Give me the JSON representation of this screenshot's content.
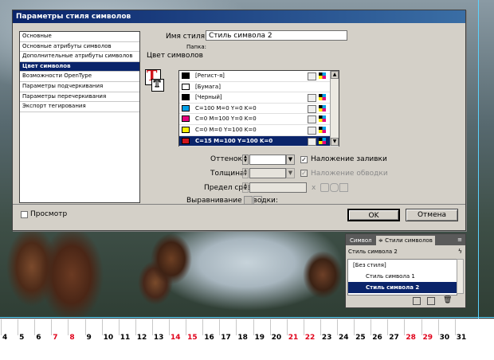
{
  "dialog": {
    "title": "Параметры стиля символов",
    "style_name_label": "Имя стиля:",
    "style_name_value": "Стиль символа 2",
    "folder_label": "Папка:",
    "section_title": "Цвет символов",
    "nav_items": [
      {
        "label": "Основные",
        "selected": false
      },
      {
        "label": "Основные атрибуты символов",
        "selected": false
      },
      {
        "label": "Дополнительные атрибуты символов",
        "selected": false
      },
      {
        "label": "Цвет символов",
        "selected": true
      },
      {
        "label": "Возможности OpenType",
        "selected": false
      },
      {
        "label": "Параметры подчеркивания",
        "selected": false
      },
      {
        "label": "Параметры перечеркивания",
        "selected": false
      },
      {
        "label": "Экспорт тегирования",
        "selected": false
      }
    ],
    "swatches": [
      {
        "name": "[Регист-я]",
        "color": "#000000",
        "selected": false
      },
      {
        "name": "[Бумага]",
        "color": "#ffffff",
        "selected": false
      },
      {
        "name": "[Черный]",
        "color": "#000000",
        "selected": false
      },
      {
        "name": "C=100 M=0 Y=0 K=0",
        "color": "#00a0e6",
        "selected": false
      },
      {
        "name": "C=0 M=100 Y=0 K=0",
        "color": "#e6007e",
        "selected": false
      },
      {
        "name": "C=0 M=0 Y=100 K=0",
        "color": "#fff000",
        "selected": false
      },
      {
        "name": "C=15 M=100 Y=100 K=0",
        "color": "#d2151c",
        "selected": true
      }
    ],
    "tint_label": "Оттенок:",
    "overprint_fill_label": "Наложение заливки",
    "weight_label": "Толщина:",
    "overprint_stroke_label": "Наложение обводки",
    "miter_label": "Предел среза:",
    "miter_unit": "x",
    "stroke_align_label": "Выравнивание обводки:",
    "preview_label": "Просмотр",
    "ok_label": "OK",
    "cancel_label": "Отмена"
  },
  "panel": {
    "tab_swatches": "Символ",
    "tab_styles": "≑ Стили символов",
    "current_style": "Стиль символа 2",
    "items": [
      {
        "label": "[Без стиля]",
        "selected": false
      },
      {
        "label": "Стиль символа 1",
        "selected": false
      },
      {
        "label": "Стиль символа 2",
        "selected": true
      }
    ]
  },
  "ruler": {
    "numbers": [
      {
        "n": "4",
        "red": false
      },
      {
        "n": "5",
        "red": false
      },
      {
        "n": "6",
        "red": false
      },
      {
        "n": "7",
        "red": true
      },
      {
        "n": "8",
        "red": true
      },
      {
        "n": "9",
        "red": false
      },
      {
        "n": "10",
        "red": false
      },
      {
        "n": "11",
        "red": false
      },
      {
        "n": "12",
        "red": false
      },
      {
        "n": "13",
        "red": false
      },
      {
        "n": "14",
        "red": true
      },
      {
        "n": "15",
        "red": true
      },
      {
        "n": "16",
        "red": false
      },
      {
        "n": "17",
        "red": false
      },
      {
        "n": "18",
        "red": false
      },
      {
        "n": "19",
        "red": false
      },
      {
        "n": "20",
        "red": false
      },
      {
        "n": "21",
        "red": true
      },
      {
        "n": "22",
        "red": true
      },
      {
        "n": "23",
        "red": false
      },
      {
        "n": "24",
        "red": false
      },
      {
        "n": "25",
        "red": false
      },
      {
        "n": "26",
        "red": false
      },
      {
        "n": "27",
        "red": false
      },
      {
        "n": "28",
        "red": true
      },
      {
        "n": "29",
        "red": true
      },
      {
        "n": "30",
        "red": false
      },
      {
        "n": "31",
        "red": false
      }
    ]
  },
  "colors": {
    "accent": "#0a246a",
    "weekend": "#e0001a"
  }
}
